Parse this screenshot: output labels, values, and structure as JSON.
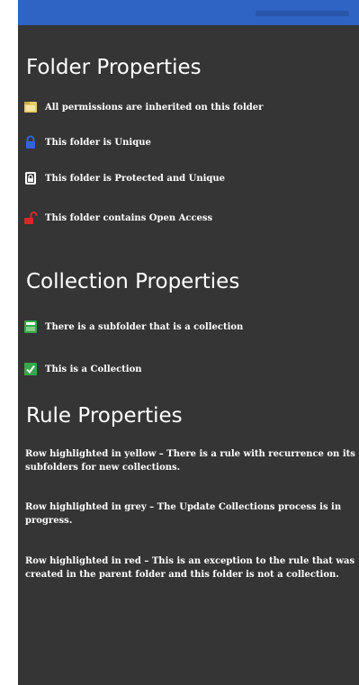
{
  "folder_properties": {
    "title": "Folder Properties",
    "items": [
      {
        "icon": "folder-icon",
        "label": "All permissions are inherited on this folder"
      },
      {
        "icon": "lock-icon",
        "label": "This folder is Unique"
      },
      {
        "icon": "protected-lock-icon",
        "label": "This folder is Protected and Unique"
      },
      {
        "icon": "open-lock-icon",
        "label": "This folder contains Open Access"
      }
    ]
  },
  "collection_properties": {
    "title": "Collection Properties",
    "items": [
      {
        "icon": "subfolder-collection-icon",
        "label": "There is a subfolder that is a collection"
      },
      {
        "icon": "collection-check-icon",
        "label": "This is a Collection"
      }
    ]
  },
  "rule_properties": {
    "title": "Rule Properties",
    "paragraphs": [
      "Row highlighted in yellow – There is a rule with recurrence on its subfolders for new collections.",
      "Row highlighted in grey – The Update Collections process is in progress.",
      "Row highlighted in red – This is an exception to the rule that was created in the parent folder and this folder is not a collection."
    ]
  },
  "colors": {
    "top_bar": "#2f63c4",
    "panel_background": "#353535",
    "text": "#ffffff",
    "folder_icon": "#e8cc6a",
    "lock_icon": "#2f66d8",
    "protected_icon": "#ffffff",
    "open_lock_icon": "#d42a2a",
    "collection_icon": "#39a64a"
  }
}
